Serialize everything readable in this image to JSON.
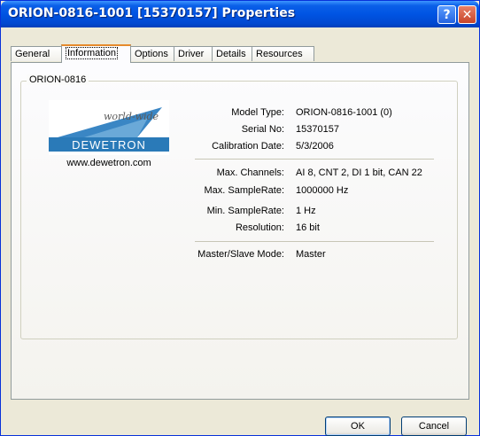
{
  "window": {
    "title": "ORION-0816-1001 [15370157] Properties"
  },
  "titlebar_buttons": {
    "help": "?",
    "close": "✕"
  },
  "tabs": [
    "General",
    "Information",
    "Options",
    "Driver",
    "Details",
    "Resources"
  ],
  "active_tab": "Information",
  "group": {
    "legend": "ORION-0816"
  },
  "logo": {
    "script_text": "world-wide",
    "brand": "DEWETRON",
    "url": "www.dewetron.com"
  },
  "info": [
    {
      "label": "Model Type:",
      "value": "ORION-0816-1001 (0)"
    },
    {
      "label": "Serial No:",
      "value": "15370157"
    },
    {
      "label": "Calibration Date:",
      "value": "5/3/2006"
    },
    {
      "label": "Max. Channels:",
      "value": "AI 8, CNT 2, DI 1 bit, CAN 22"
    },
    {
      "label": "Max. SampleRate:",
      "value": "1000000 Hz"
    },
    {
      "label": "Min. SampleRate:",
      "value": "1 Hz"
    },
    {
      "label": "Resolution:",
      "value": "16 bit"
    },
    {
      "label": "Master/Slave Mode:",
      "value": "Master"
    }
  ],
  "buttons": {
    "ok": "OK",
    "cancel": "Cancel"
  },
  "colors": {
    "titlebar": "#0054e3",
    "tab_highlight": "#e68b2c",
    "brand_blue": "#2a7ab8"
  }
}
